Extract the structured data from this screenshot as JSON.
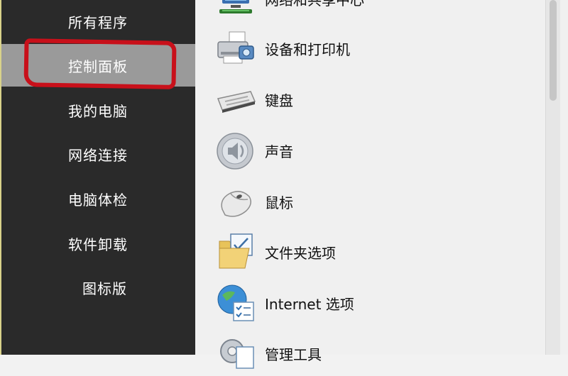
{
  "sidebar": {
    "items": [
      {
        "label": "所有程序"
      },
      {
        "label": "控制面板"
      },
      {
        "label": "我的电脑"
      },
      {
        "label": "网络连接"
      },
      {
        "label": "电脑体检"
      },
      {
        "label": "软件卸载"
      },
      {
        "label": "图标版"
      }
    ],
    "selected_index": 1,
    "annotation_color": "#c8101a"
  },
  "panel": {
    "items": [
      {
        "label": "网络和共享中心",
        "icon": "network-icon"
      },
      {
        "label": "设备和打印机",
        "icon": "printer-icon"
      },
      {
        "label": "键盘",
        "icon": "keyboard-icon"
      },
      {
        "label": "声音",
        "icon": "speaker-icon"
      },
      {
        "label": "鼠标",
        "icon": "mouse-icon"
      },
      {
        "label": "文件夹选项",
        "icon": "folder-options-icon"
      },
      {
        "label": "Internet 选项",
        "icon": "internet-options-icon"
      },
      {
        "label": "管理工具",
        "icon": "admin-tools-icon"
      }
    ]
  }
}
